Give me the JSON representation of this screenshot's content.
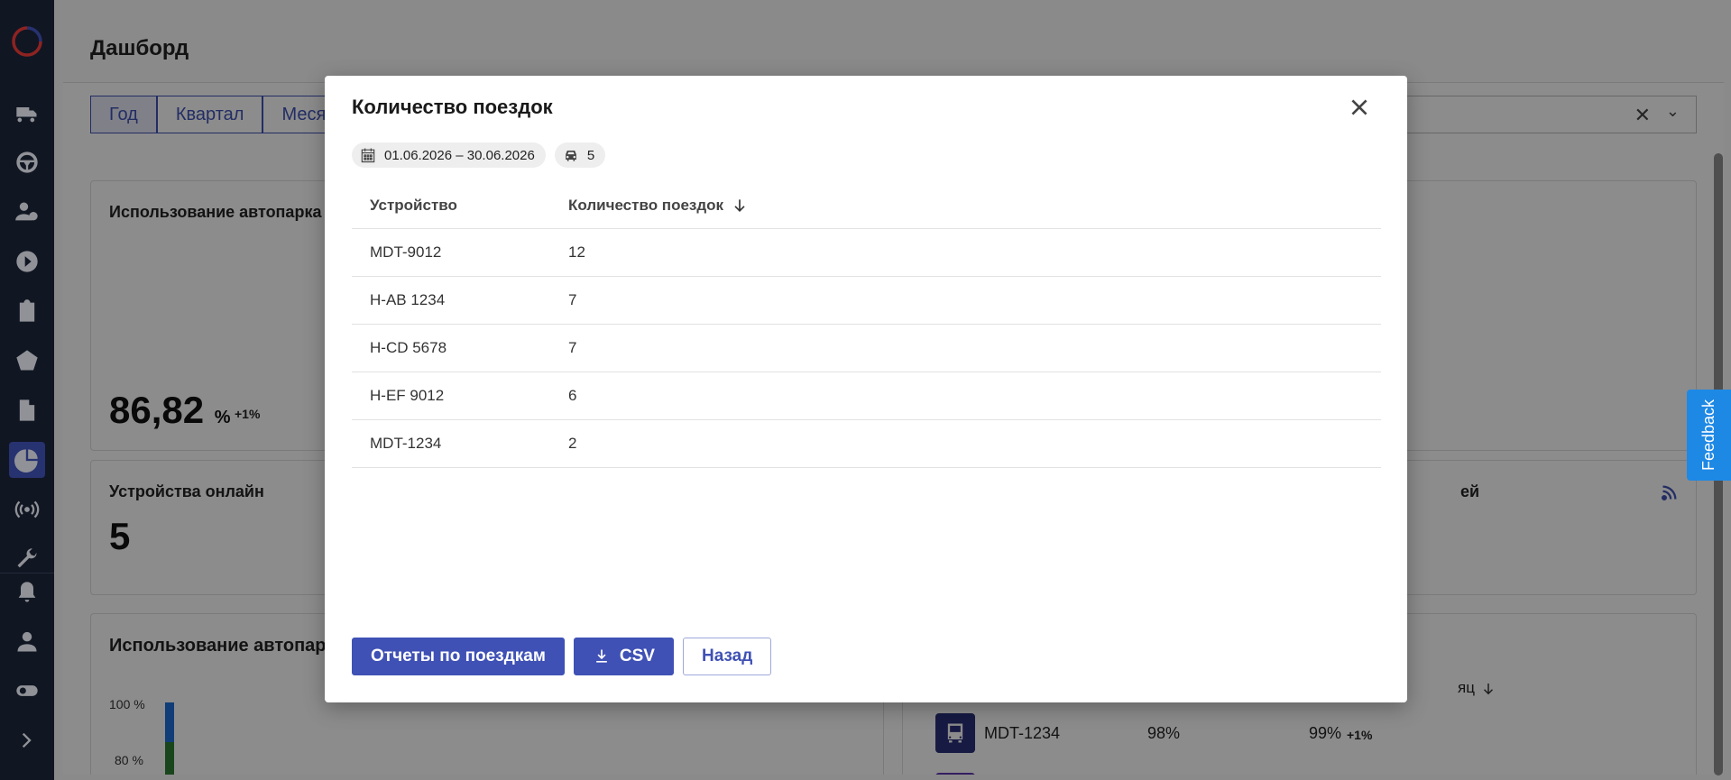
{
  "page": {
    "title": "Дашборд",
    "tabs": [
      "Год",
      "Квартал",
      "Меся"
    ],
    "cards": {
      "fleet_usage": {
        "title": "Использование автопарка",
        "value": "86,82",
        "unit": "%",
        "delta": "+1%"
      },
      "devices_online": {
        "title": "Устройства онлайн",
        "value": "5"
      },
      "right_partial_title": "ей",
      "fleet_usage_chart": {
        "title": "Использование автопарк",
        "y_labels": [
          "100 %",
          "80 %"
        ]
      },
      "right_list": {
        "sort_label": "яц",
        "row": {
          "name": "MDT-1234",
          "v1": "98%",
          "v2": "99%",
          "delta": "+1%"
        }
      }
    }
  },
  "feedback": {
    "label": "Feedback"
  },
  "modal": {
    "title": "Количество поездок",
    "chips": {
      "date_range": "01.06.2026 – 30.06.2026",
      "vehicle_count": "5"
    },
    "table": {
      "columns": [
        "Устройство",
        "Количество поездок"
      ],
      "rows": [
        {
          "device": "MDT-9012",
          "trips": "12"
        },
        {
          "device": "H-AB 1234",
          "trips": "7"
        },
        {
          "device": "H-CD 5678",
          "trips": "7"
        },
        {
          "device": "H-EF 9012",
          "trips": "6"
        },
        {
          "device": "MDT-1234",
          "trips": "2"
        }
      ]
    },
    "actions": {
      "trip_reports": "Отчеты по поездкам",
      "csv": "CSV",
      "back": "Назад"
    }
  },
  "colors": {
    "primary": "#3f51b5",
    "sidebar": "#1b2438",
    "feedback": "#1e88e5"
  }
}
